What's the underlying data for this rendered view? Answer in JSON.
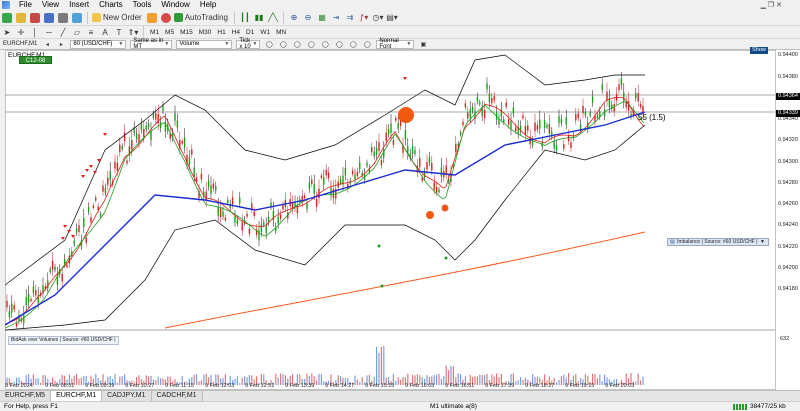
{
  "menubar": {
    "items": [
      "File",
      "View",
      "Insert",
      "Charts",
      "Tools",
      "Window",
      "Help"
    ]
  },
  "toolbar": {
    "new_order_label": "New Order",
    "autotrading_label": "AutoTrading",
    "timeframes": [
      "M1",
      "M5",
      "M15",
      "M30",
      "H1",
      "H4",
      "D1",
      "W1",
      "MN"
    ],
    "sym_combo": "60 (USD/CHF)",
    "mode_combo": "Same as in MT",
    "vol_combo": "Volume",
    "tick_combo": "Tick x 10",
    "font_combo": "Normal Font"
  },
  "chart": {
    "title": "EURCHF,M1",
    "buy_badge": "C12-08",
    "show_button": "Show",
    "annotation": "55 (1.5)",
    "price_labels": [
      "0.94400",
      "0.94380",
      "0.94360",
      "0.94340",
      "0.94320",
      "0.94300",
      "0.94280",
      "0.94260",
      "0.94240",
      "0.94220",
      "0.94200",
      "0.94180"
    ],
    "price_tags": [
      {
        "label": "0.94364",
        "bg": "#000000"
      },
      {
        "label": "0.94339",
        "bg": "#000000"
      }
    ],
    "time_labels": [
      "9 Feb 2024",
      "9 Feb 08:51",
      "9 Feb 09:39",
      "9 Feb 10:27",
      "9 Feb 11:15",
      "9 Feb 12:03",
      "9 Feb 12:51",
      "9 Feb 13:39",
      "9 Feb 14:27",
      "9 Feb 15:15",
      "9 Feb 16:03",
      "9 Feb 16:51",
      "9 Feb 17:39",
      "9 Feb 18:27",
      "9 Feb 19:15",
      "9 Feb 20:03"
    ],
    "indicator_label": "Imbalance | Source: #60 USD/CHF |",
    "subwindow_label": "BidAsk over Volumes | Source: #60 USD/CHF |",
    "subwindow_value": "632"
  },
  "tabs": [
    "EURCHF,M5",
    "EURCHF,M1",
    "CADJPY,M1",
    "CADCHF,M1"
  ],
  "active_tab": 1,
  "status": {
    "help": "For Help, press F1",
    "profile": "M1 ultimate a(8)",
    "traffic": "38477/25 kb"
  },
  "colors": {
    "ma_blue": "#1a2bd4",
    "ma_orange": "#ff5a1a",
    "bollinger": "#000000",
    "ma_green": "#1e9e1e",
    "ma_red": "#e0201a",
    "signal_circle": "#f25a10"
  }
}
